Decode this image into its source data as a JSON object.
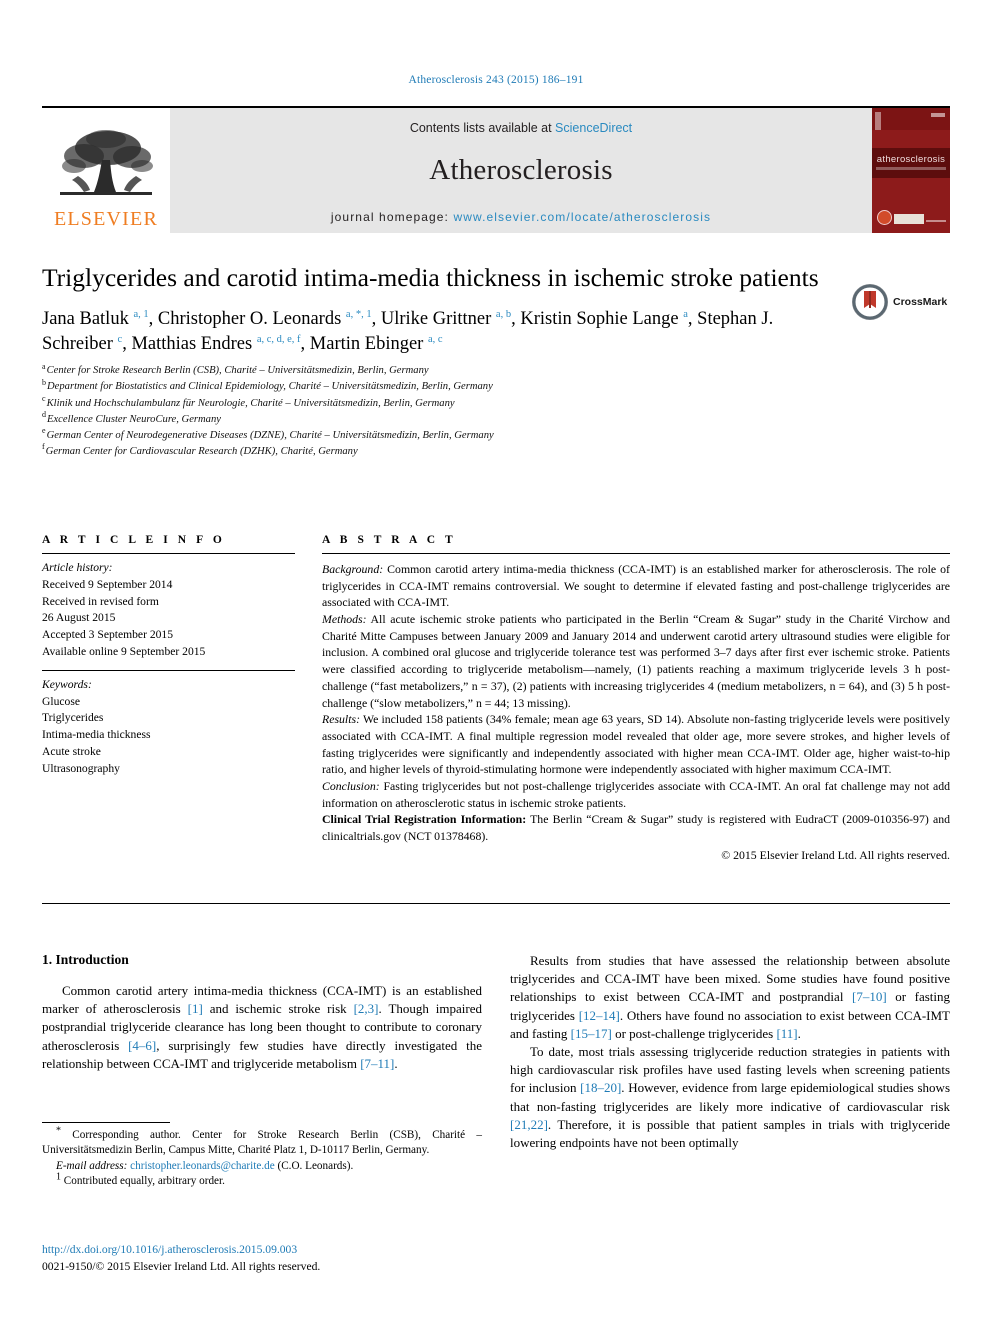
{
  "running_head": "Atherosclerosis 243 (2015) 186–191",
  "masthead": {
    "publisher_logo_text": "ELSEVIER",
    "contents_prefix": "Contents lists available at ",
    "contents_link": "ScienceDirect",
    "journal_name": "Atherosclerosis",
    "homepage_prefix": "journal homepage: ",
    "homepage_url": "www.elsevier.com/locate/atherosclerosis",
    "cover_title": "atherosclerosis"
  },
  "article": {
    "title": "Triglycerides and carotid intima-media thickness in ischemic stroke patients",
    "crossmark_label": "CrossMark",
    "authors_line1": "Jana Batluk",
    "authors": [
      {
        "name": "Jana Batluk",
        "marks": "a, 1",
        "sep": ", "
      },
      {
        "name": "Christopher O. Leonards",
        "marks": "a, *, 1",
        "sep": ", "
      },
      {
        "name": "Ulrike Grittner",
        "marks": "a, b",
        "sep": ", "
      },
      {
        "name": "Kristin Sophie Lange",
        "marks": "a",
        "sep": ", "
      },
      {
        "name": "Stephan J. Schreiber",
        "marks": "c",
        "sep": ", "
      },
      {
        "name": "Matthias Endres",
        "marks": "a, c, d, e, f",
        "sep": ", "
      },
      {
        "name": "Martin Ebinger",
        "marks": "a, c",
        "sep": ""
      }
    ],
    "affiliations": [
      {
        "label": "a",
        "text": "Center for Stroke Research Berlin (CSB), Charité – Universitätsmedizin, Berlin, Germany"
      },
      {
        "label": "b",
        "text": "Department for Biostatistics and Clinical Epidemiology, Charité – Universitätsmedizin, Berlin, Germany"
      },
      {
        "label": "c",
        "text": "Klinik und Hochschulambulanz für Neurologie, Charité – Universitätsmedizin, Berlin, Germany"
      },
      {
        "label": "d",
        "text": "Excellence Cluster NeuroCure, Germany"
      },
      {
        "label": "e",
        "text": "German Center of Neurodegenerative Diseases (DZNE), Charité – Universitätsmedizin, Berlin, Germany"
      },
      {
        "label": "f",
        "text": "German Center for Cardiovascular Research (DZHK), Charité, Germany"
      }
    ]
  },
  "article_info": {
    "heading": "A R T I C L E   I N F O",
    "history_label": "Article history:",
    "history": [
      "Received 9 September 2014",
      "Received in revised form",
      "26 August 2015",
      "Accepted 3 September 2015",
      "Available online 9 September 2015"
    ],
    "keywords_label": "Keywords:",
    "keywords": [
      "Glucose",
      "Triglycerides",
      "Intima-media thickness",
      "Acute stroke",
      "Ultrasonography"
    ]
  },
  "abstract": {
    "heading": "A B S T R A C T",
    "background_label": "Background:",
    "background_text": " Common carotid artery intima-media thickness (CCA-IMT) is an established marker for atherosclerosis. The role of triglycerides in CCA-IMT remains controversial. We sought to determine if elevated fasting and post-challenge triglycerides are associated with CCA-IMT.",
    "methods_label": "Methods:",
    "methods_text": " All acute ischemic stroke patients who participated in the Berlin “Cream & Sugar” study in the Charité Virchow and Charité Mitte Campuses between January 2009 and January 2014 and underwent carotid artery ultrasound studies were eligible for inclusion. A combined oral glucose and triglyceride tolerance test was performed 3–7 days after first ever ischemic stroke. Patients were classified according to triglyceride metabolism—namely, (1) patients reaching a maximum triglyceride levels 3 h post-challenge (“fast metabolizers,” n = 37), (2) patients with increasing triglycerides 4 (medium metabolizers, n = 64), and (3) 5 h post-challenge (“slow metabolizers,” n = 44; 13 missing).",
    "results_label": "Results:",
    "results_text": " We included 158 patients (34% female; mean age 63 years, SD 14). Absolute non-fasting triglyceride levels were positively associated with CCA-IMT. A final multiple regression model revealed that older age, more severe strokes, and higher levels of fasting triglycerides were significantly and independently associated with higher mean CCA-IMT. Older age, higher waist-to-hip ratio, and higher levels of thyroid-stimulating hormone were independently associated with higher maximum CCA-IMT.",
    "conclusion_label": "Conclusion:",
    "conclusion_text": " Fasting triglycerides but not post-challenge triglycerides associate with CCA-IMT. An oral fat challenge may not add information on atherosclerotic status in ischemic stroke patients.",
    "trial_label": "Clinical Trial Registration Information:",
    "trial_text": " The Berlin “Cream & Sugar” study is registered with EudraCT (2009-010356-97) and clinicaltrials.gov (NCT 01378468).",
    "copyright": "© 2015 Elsevier Ireland Ltd. All rights reserved."
  },
  "body": {
    "section_heading": "1. Introduction",
    "left_para_1_a": "Common carotid artery intima-media thickness (CCA-IMT) is an established marker of atherosclerosis ",
    "left_para_1_ref1": "[1]",
    "left_para_1_b": " and ischemic stroke risk ",
    "left_para_1_ref2": "[2,3]",
    "left_para_1_c": ". Though impaired postprandial triglyceride clearance has long been thought to contribute to coronary atherosclerosis ",
    "left_para_1_ref3": "[4–6]",
    "left_para_1_d": ", surprisingly few studies have directly investigated the relationship between CCA-IMT and triglyceride metabolism ",
    "left_para_1_ref4": "[7–11]",
    "left_para_1_e": ".",
    "right_para_1_a": "Results from studies that have assessed the relationship between absolute triglycerides and CCA-IMT have been mixed. Some studies have found positive relationships to exist between CCA-IMT and postprandial ",
    "right_para_1_ref1": "[7–10]",
    "right_para_1_b": " or fasting triglycerides ",
    "right_para_1_ref2": "[12–14]",
    "right_para_1_c": ". Others have found no association to exist between CCA-IMT and fasting ",
    "right_para_1_ref3": "[15–17]",
    "right_para_1_d": " or post-challenge triglycerides ",
    "right_para_1_ref4": "[11]",
    "right_para_1_e": ".",
    "right_para_2_a": "To date, most trials assessing triglyceride reduction strategies in patients with high cardiovascular risk profiles have used fasting levels when screening patients for inclusion ",
    "right_para_2_ref1": "[18–20]",
    "right_para_2_b": ". However, evidence from large epidemiological studies shows that non-fasting triglycerides are likely more indicative of cardiovascular risk ",
    "right_para_2_ref2": "[21,22]",
    "right_para_2_c": ". Therefore, it is possible that patient samples in trials with triglyceride lowering endpoints have not been optimally"
  },
  "footnotes": {
    "corresponding_mark": "*",
    "corresponding_text": " Corresponding author. Center for Stroke Research Berlin (CSB), Charité – Universitätsmedizin Berlin, Campus Mitte, Charité Platz 1, D-10117 Berlin, Germany.",
    "email_label": "E-mail address:",
    "email_address": "christopher.leonards@charite.de",
    "email_suffix": " (C.O. Leonards).",
    "note1_mark": "1",
    "note1_text": " Contributed equally, arbitrary order.",
    "doi_url": "http://dx.doi.org/10.1016/j.atherosclerosis.2015.09.003",
    "issn_line": "0021-9150/© 2015 Elsevier Ireland Ltd. All rights reserved."
  },
  "colors": {
    "link_blue": "#1f7bb6",
    "sciencedirect_blue": "#2a8ac0",
    "elsevier_orange": "#ef7d22",
    "cover_red": "#8d1b1b"
  }
}
